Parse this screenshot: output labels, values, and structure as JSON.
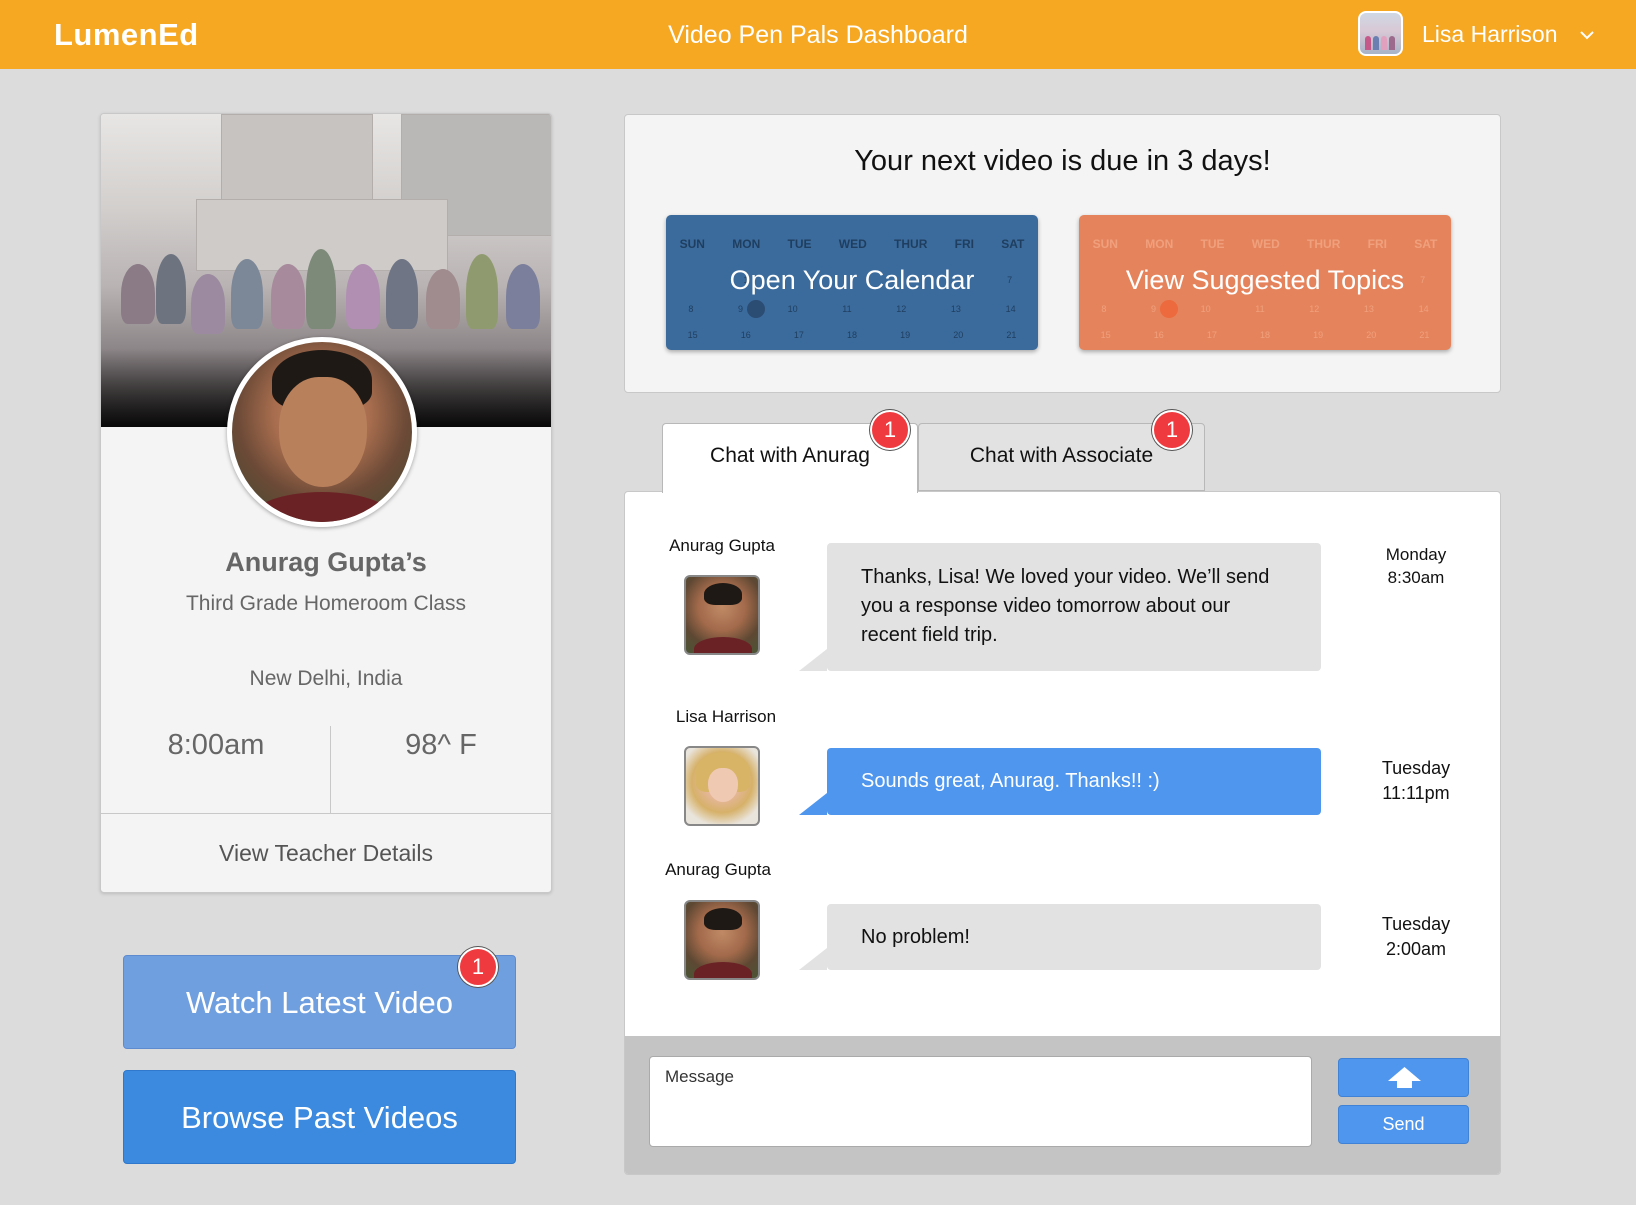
{
  "header": {
    "logo": "LumenEd",
    "title": "Video Pen Pals Dashboard",
    "user_name": "Lisa Harrison",
    "background_color": "#f6a823"
  },
  "profile": {
    "teacher_name": "Anurag Gupta’s",
    "class_name": "Third Grade Homeroom Class",
    "location": "New Delhi, India",
    "local_time": "8:00am",
    "temperature": "98^ F",
    "details_link": "View Teacher Details"
  },
  "video_buttons": {
    "watch_label": "Watch Latest Video",
    "watch_badge": "1",
    "browse_label": "Browse Past Videos"
  },
  "due": {
    "title": "Your next video is due in 3 days!",
    "calendar_label": "Open Your Calendar",
    "topics_label": "View Suggested Topics",
    "weekdays": [
      "SUN",
      "MON",
      "TUE",
      "WED",
      "THUR",
      "FRI",
      "SAT"
    ],
    "week_rows": [
      [
        "",
        "1",
        "",
        "",
        "",
        "",
        "7"
      ],
      [
        "8",
        "9",
        "10",
        "11",
        "12",
        "13",
        "14"
      ],
      [
        "15",
        "16",
        "17",
        "18",
        "19",
        "20",
        "21"
      ]
    ]
  },
  "tabs": [
    {
      "label": "Chat with Anurag",
      "badge": "1",
      "active": true
    },
    {
      "label": "Chat with Associate",
      "badge": "1",
      "active": false
    }
  ],
  "messages": [
    {
      "author": "Anurag Gupta",
      "text": "Thanks, Lisa! We loved your video. We’ll send you a response video tomorrow about our recent field trip.",
      "day": "Monday",
      "time": "8:30am",
      "style": "grey"
    },
    {
      "author": "Lisa Harrison",
      "text": "Sounds great, Anurag. Thanks!! :)",
      "day": "Tuesday",
      "time": "11:11pm",
      "style": "blue"
    },
    {
      "author": "Anurag Gupta",
      "text": "No problem!",
      "day": "Tuesday",
      "time": "2:00am",
      "style": "grey"
    }
  ],
  "compose": {
    "placeholder": "Message",
    "send_label": "Send",
    "upload_icon": "upload-arrow-icon"
  }
}
